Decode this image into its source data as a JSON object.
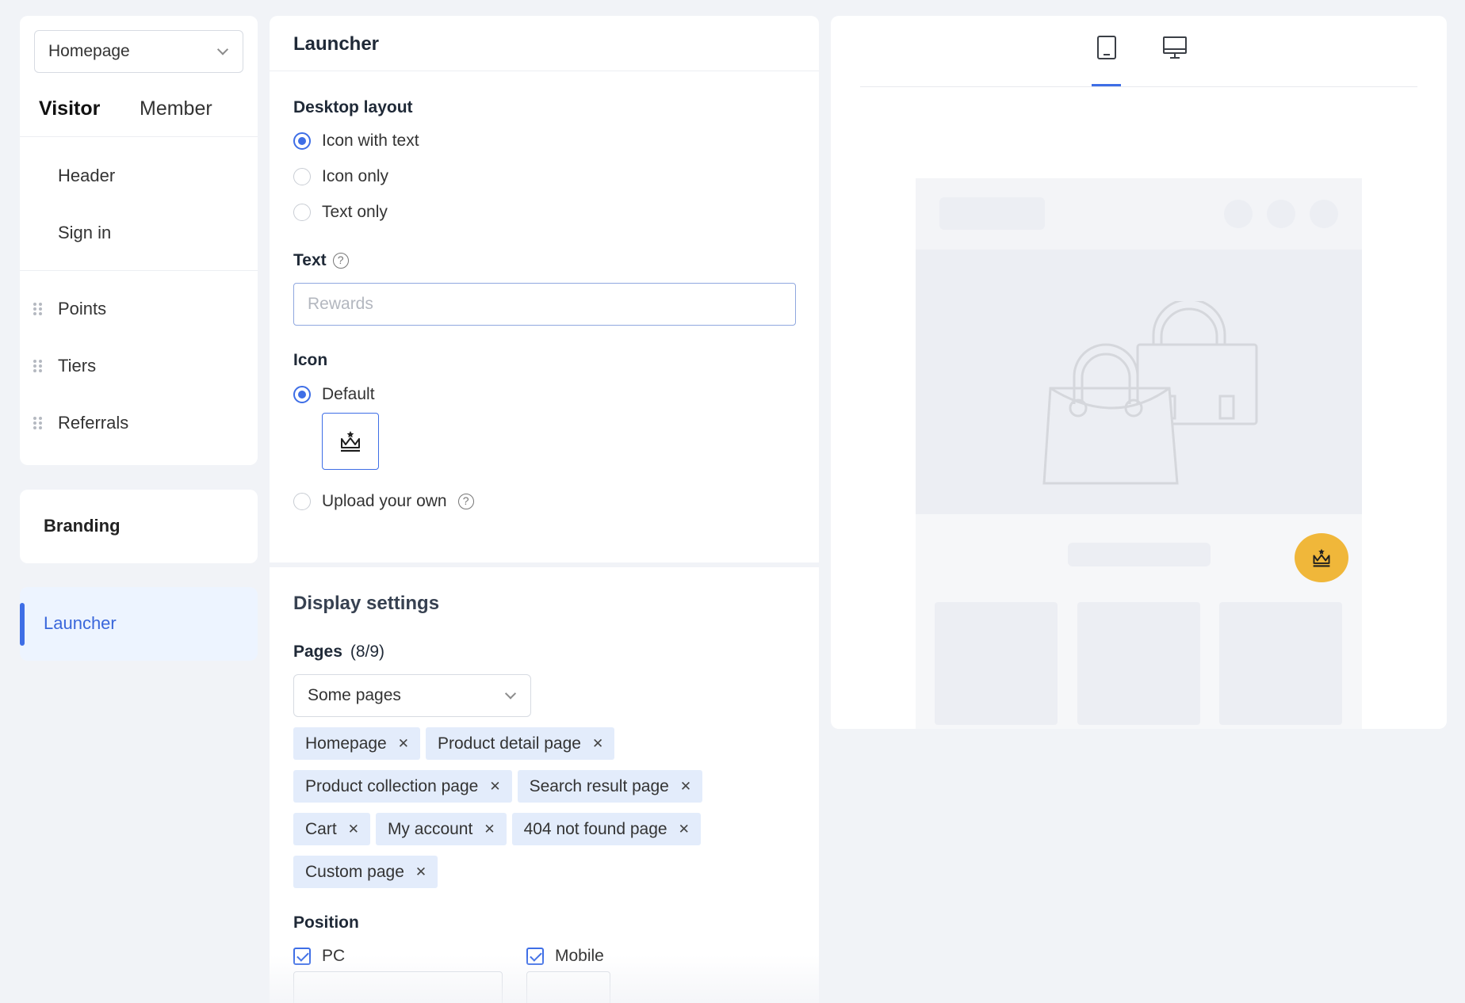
{
  "sidebar": {
    "page_select": "Homepage",
    "segments": [
      "Visitor",
      "Member"
    ],
    "items_top": [
      "Header",
      "Sign in"
    ],
    "items_drag": [
      "Points",
      "Tiers",
      "Referrals"
    ],
    "branding": "Branding",
    "launcher": "Launcher"
  },
  "launcher": {
    "title": "Launcher",
    "desktop_layout_label": "Desktop layout",
    "layout_options": [
      "Icon with text",
      "Icon only",
      "Text only"
    ],
    "layout_selected": "Icon with text",
    "text_label": "Text",
    "text_placeholder": "Rewards",
    "icon_label": "Icon",
    "icon_default_label": "Default",
    "icon_upload_label": "Upload your own",
    "icon_selected": "Default"
  },
  "display": {
    "title": "Display settings",
    "pages_label": "Pages",
    "pages_count": "(8/9)",
    "pages_select": "Some pages",
    "tags": [
      "Homepage",
      "Product detail page",
      "Product collection page",
      "Search result page",
      "Cart",
      "My account",
      "404 not found page",
      "Custom page"
    ],
    "position_label": "Position",
    "pc_label": "PC",
    "mobile_label": "Mobile"
  },
  "preview": {
    "device_tabs": [
      "mobile-icon",
      "desktop-icon"
    ],
    "active_tab": "mobile-icon",
    "launcher_color": "#f0b73a"
  },
  "colors": {
    "accent": "#3e6ee6",
    "tag_bg": "#e3ecfb",
    "active_nav_bg": "#edf4ff"
  }
}
